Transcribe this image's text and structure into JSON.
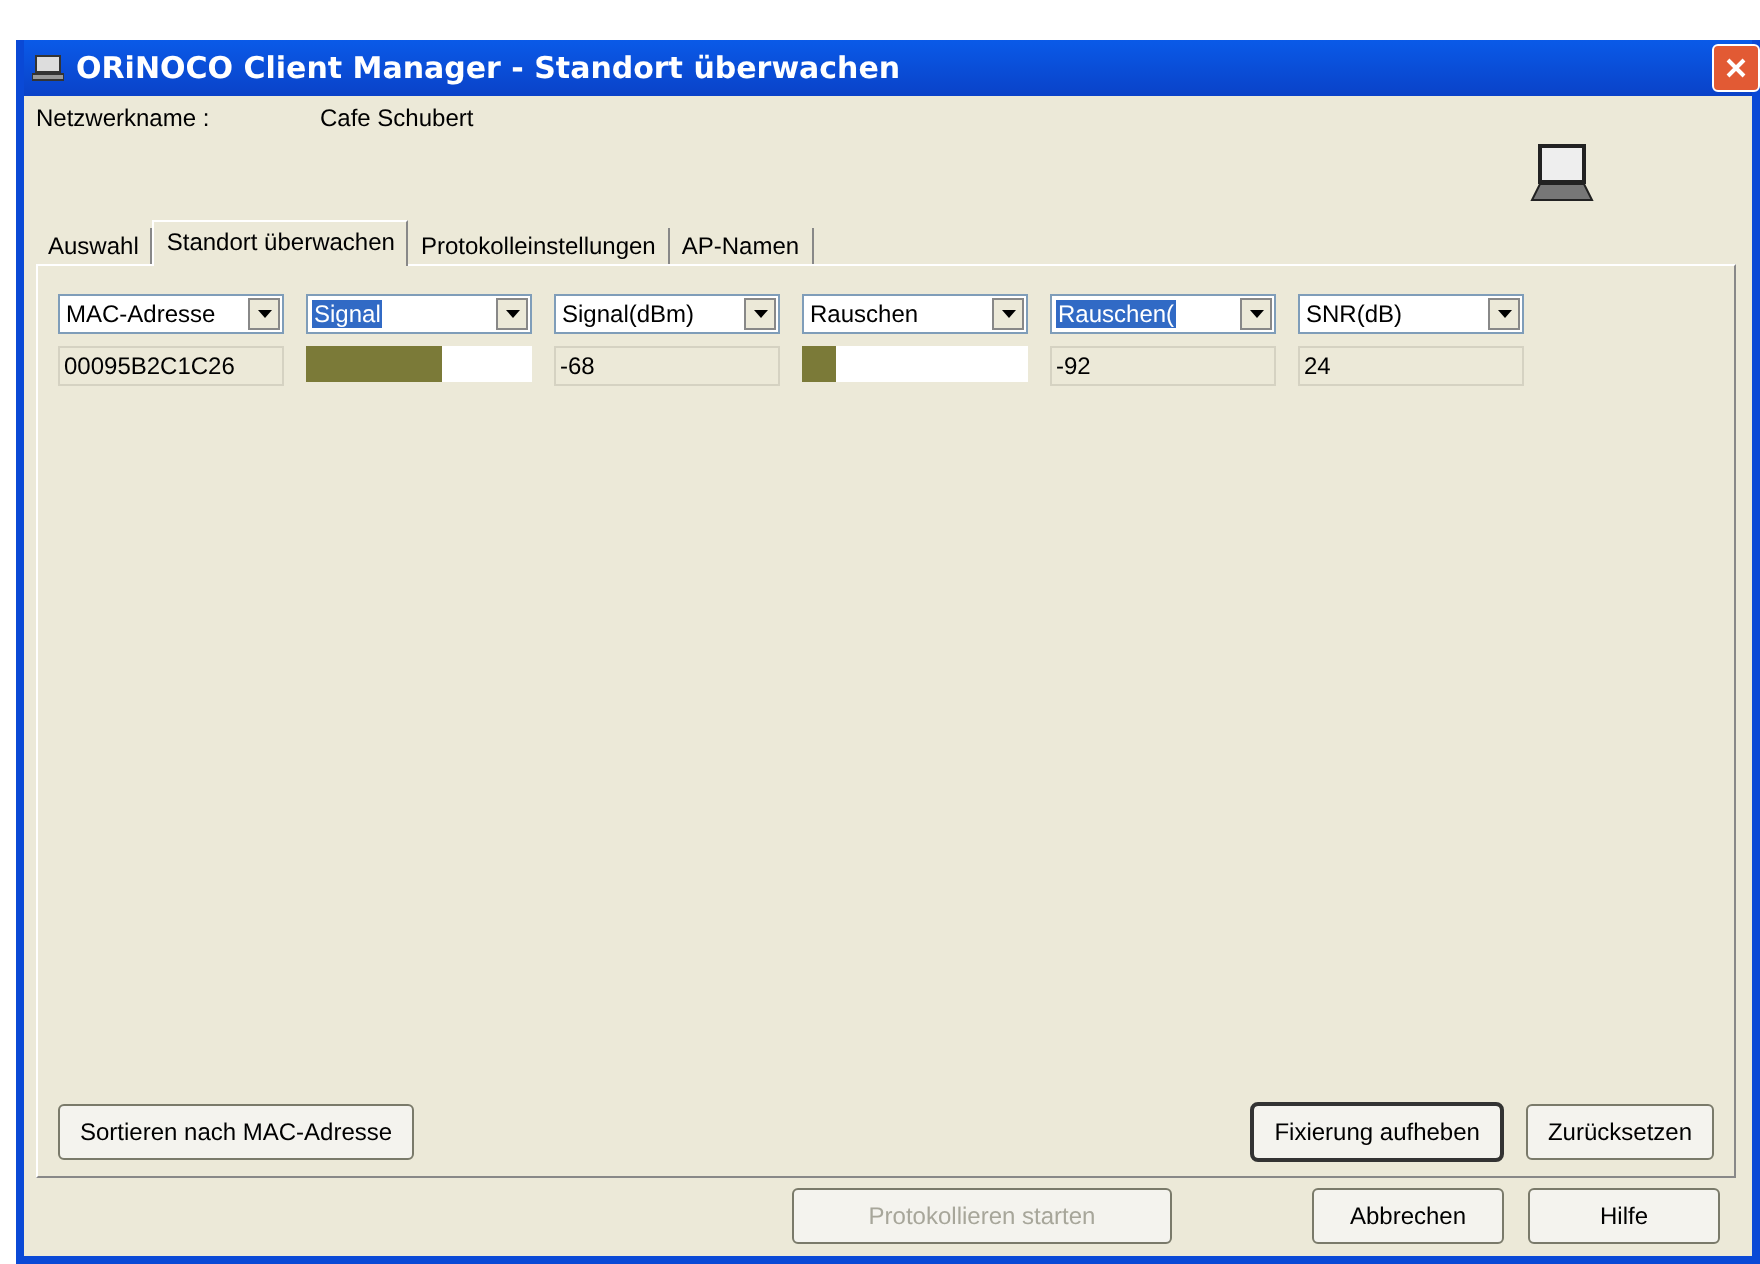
{
  "window": {
    "title": "ORiNOCO Client Manager - Standort überwachen"
  },
  "network": {
    "label": "Netzwerkname :",
    "value": "Cafe Schubert"
  },
  "tabs": [
    {
      "label": "Auswahl",
      "selected": false
    },
    {
      "label": "Standort überwachen",
      "selected": true
    },
    {
      "label": "Protokolleinstellungen",
      "selected": false
    },
    {
      "label": "AP-Namen",
      "selected": false
    }
  ],
  "columns": [
    {
      "header": "MAC-Adresse",
      "highlighted": false,
      "cell": {
        "kind": "text",
        "value": "00095B2C1C26"
      }
    },
    {
      "header": "Signal",
      "highlighted": true,
      "cell": {
        "kind": "bar",
        "level": 0.6
      }
    },
    {
      "header": "Signal(dBm)",
      "highlighted": false,
      "cell": {
        "kind": "text",
        "value": "-68"
      }
    },
    {
      "header": "Rauschen",
      "highlighted": false,
      "cell": {
        "kind": "bar",
        "level": 0.15
      }
    },
    {
      "header": "Rauschen(",
      "highlighted": true,
      "cell": {
        "kind": "text",
        "value": "-92"
      }
    },
    {
      "header": "SNR(dB)",
      "highlighted": false,
      "cell": {
        "kind": "text",
        "value": "24"
      }
    }
  ],
  "panel_buttons": [
    {
      "label": "Sortieren nach MAC-Adresse",
      "default": false
    },
    {
      "label": "Fixierung aufheben",
      "default": true
    },
    {
      "label": "Zurücksetzen",
      "default": false
    }
  ],
  "footer_buttons": [
    {
      "label": "Protokollieren starten",
      "disabled": true
    },
    {
      "label": "Abbrechen",
      "disabled": false
    },
    {
      "label": "Hilfe",
      "disabled": false
    }
  ]
}
